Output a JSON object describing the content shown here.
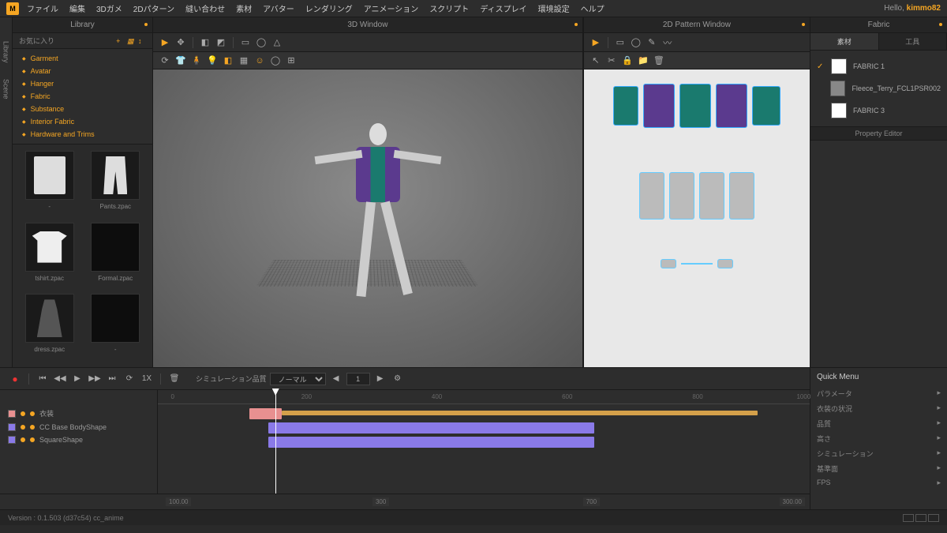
{
  "menubar": {
    "items": [
      "ファイル",
      "編集",
      "3Dガメ",
      "2Dパターン",
      "縫い合わせ",
      "素材",
      "アバター",
      "レンダリング",
      "アニメーション",
      "スクリプト",
      "ディスプレイ",
      "環境設定",
      "ヘルプ"
    ]
  },
  "user": {
    "prefix": "Hello,",
    "name": "kimmo82"
  },
  "sidebar_tabs": [
    "Library",
    "Scene"
  ],
  "library": {
    "title": "Library",
    "favorites": "お気に入り",
    "categories": [
      "Garment",
      "Avatar",
      "Hanger",
      "Fabric",
      "Substance",
      "Interior Fabric",
      "Hardware and Trims"
    ],
    "thumbs": [
      {
        "label": "-",
        "shape": "garment"
      },
      {
        "label": "Pants.zpac",
        "shape": "pants"
      },
      {
        "label": "tshirt.zpac",
        "shape": "shirt"
      },
      {
        "label": "Formal.zpac",
        "shape": "dark"
      },
      {
        "label": "dress.zpac",
        "shape": "dress"
      },
      {
        "label": "-",
        "shape": "dark"
      }
    ]
  },
  "viewport3d": {
    "title": "3D Window"
  },
  "viewport2d": {
    "title": "2D Pattern Window"
  },
  "fabric_panel": {
    "title": "Fabric",
    "tabs": [
      "素材",
      "工具"
    ],
    "items": [
      {
        "name": "FABRIC 1",
        "checked": true,
        "swatch": "white"
      },
      {
        "name": "Fleece_Terry_FCL1PSR002",
        "checked": false,
        "swatch": "grey"
      },
      {
        "name": "FABRIC 3",
        "checked": false,
        "swatch": "white"
      }
    ],
    "property_editor": "Property Editor"
  },
  "timeline": {
    "controls": {
      "sim_label": "シミュレーション品質",
      "sim_value": "ノーマル",
      "frame": "1"
    },
    "tracks": [
      {
        "name": "衣装",
        "color": "#e89090"
      },
      {
        "name": "CC Base BodyShape",
        "color": "#8a7ae8"
      },
      {
        "name": "SquareShape",
        "color": "#8a7ae8"
      }
    ],
    "ruler": [
      "0",
      "200",
      "400",
      "600",
      "800",
      "1000"
    ],
    "footer_marks": [
      "100.00",
      "300",
      "700",
      "300.00"
    ],
    "playhead_pct": 18
  },
  "quickmenu": {
    "title": "Quick Menu",
    "items": [
      "パラメータ",
      "衣装の状況",
      "品質",
      "高さ",
      "シミュレーション",
      "基準面",
      "FPS"
    ]
  },
  "status": {
    "text": "Version : 0.1.503 (d37c54)   cc_anime"
  }
}
